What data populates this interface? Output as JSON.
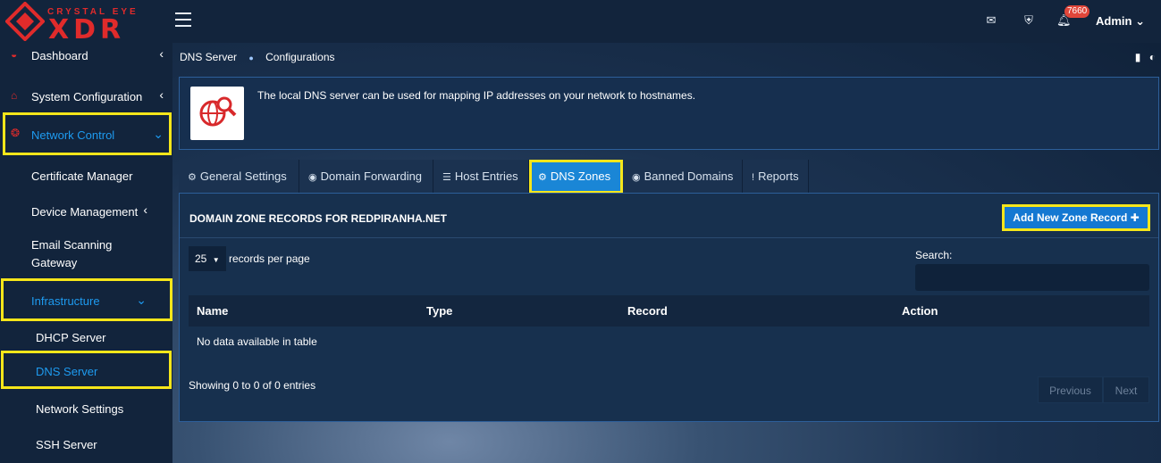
{
  "brand": {
    "top": "CRYSTAL EYE",
    "main": "XDR"
  },
  "header": {
    "notification_count": "7660",
    "user": "Admin"
  },
  "sidebar": {
    "items": [
      {
        "label": "Dashboard"
      },
      {
        "label": "System Configuration"
      },
      {
        "label": "Network Control"
      },
      {
        "label": "Certificate Manager"
      },
      {
        "label": "Device Management"
      },
      {
        "label": "Email Scanning Gateway"
      },
      {
        "label": "Infrastructure"
      },
      {
        "label": "DHCP Server"
      },
      {
        "label": "DNS Server"
      },
      {
        "label": "Network Settings"
      },
      {
        "label": "SSH Server"
      }
    ]
  },
  "breadcrumb": {
    "page": "DNS Server",
    "sub": "Configurations"
  },
  "info": {
    "text": "The local DNS server can be used for mapping IP addresses on your network to hostnames."
  },
  "tabs": [
    {
      "label": "General Settings",
      "icon": "gears-icon"
    },
    {
      "label": "Domain Forwarding",
      "icon": "globe-icon"
    },
    {
      "label": "Host Entries",
      "icon": "list-icon"
    },
    {
      "label": "DNS Zones",
      "icon": "gear-icon"
    },
    {
      "label": "Banned Domains",
      "icon": "globe-icon"
    },
    {
      "label": "Reports",
      "icon": "exclamation-icon"
    }
  ],
  "panel": {
    "title": "DOMAIN ZONE RECORDS FOR REDPIRANHA.NET",
    "add_button": "Add New Zone Record",
    "page_length": "25",
    "records_label": "records per page",
    "search_label": "Search:",
    "columns": [
      "Name",
      "Type",
      "Record",
      "Action"
    ],
    "empty_message": "No data available in table",
    "info": "Showing 0 to 0 of 0 entries",
    "previous": "Previous",
    "next": "Next"
  },
  "colors": {
    "accent": "#1a86d6",
    "highlight": "#f6e61a",
    "brand": "#e02b2b"
  }
}
